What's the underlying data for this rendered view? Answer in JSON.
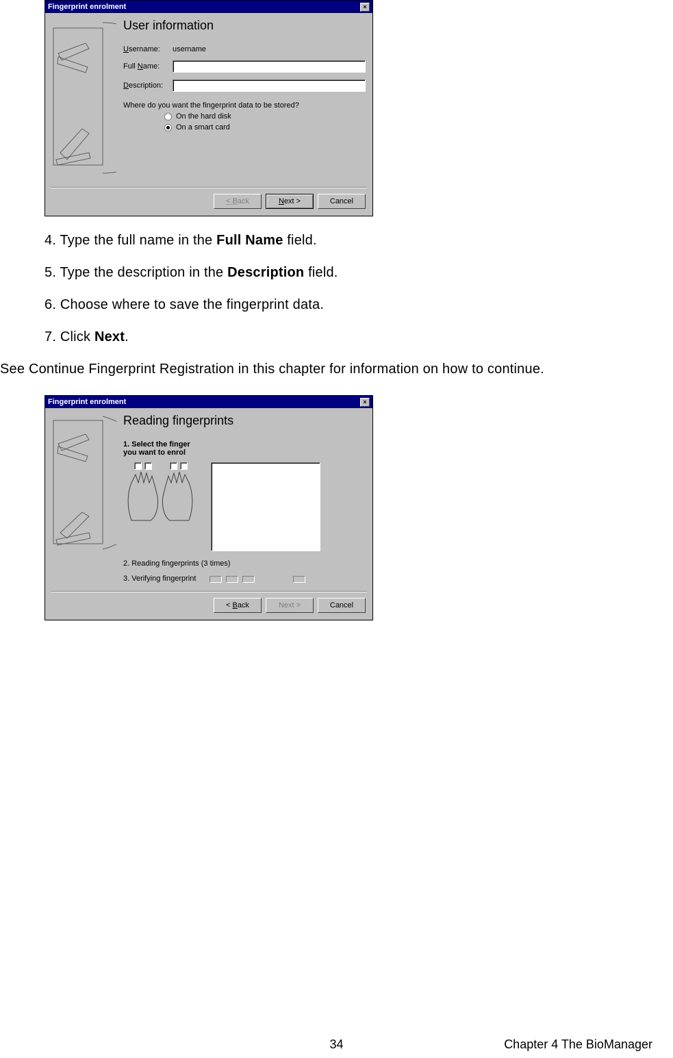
{
  "dialog1": {
    "title": "Fingerprint enrolment",
    "heading": "User information",
    "username_label": "Username:",
    "username_value": "username",
    "fullname_label": "Full Name:",
    "description_label": "Description:",
    "storage_question": "Where do you want the fingerprint data to be stored?",
    "option_disk": "On the hard disk",
    "option_card": "On a smart card",
    "back": "< Back",
    "next": "Next >",
    "cancel": "Cancel"
  },
  "dialog2": {
    "title": "Fingerprint enrolment",
    "heading": "Reading fingerprints",
    "step1": "1. Select the finger you want to enrol",
    "step2": "2. Reading fingerprints (3 times)",
    "step3": "3. Verifying fingerprint",
    "back": "< Back",
    "next": "Next >",
    "cancel": "Cancel"
  },
  "instructions": {
    "s4_a": "4. Type the full name in the ",
    "s4_b": "Full Name",
    "s4_c": " field.",
    "s5_a": "5. Type the description in the ",
    "s5_b": "Description",
    "s5_c": " field.",
    "s6": "6. Choose where to save the fingerprint data.",
    "s7_a": "7. Click ",
    "s7_b": "Next",
    "s7_c": "."
  },
  "note": "See Continue Fingerprint Registration in this chapter for information on how to continue.",
  "footer": {
    "page": "34",
    "chapter": "Chapter 4 The BioManager"
  }
}
